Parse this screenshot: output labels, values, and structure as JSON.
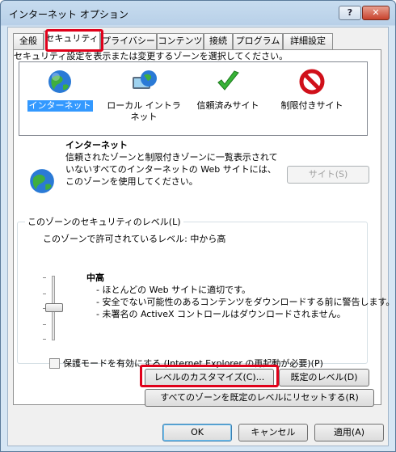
{
  "window": {
    "title": "インターネット オプション",
    "help_label": "?",
    "close_label": "✕"
  },
  "tabs": [
    {
      "label": "全般"
    },
    {
      "label": "セキュリティ"
    },
    {
      "label": "プライバシー"
    },
    {
      "label": "コンテンツ"
    },
    {
      "label": "接続"
    },
    {
      "label": "プログラム"
    },
    {
      "label": "詳細設定"
    }
  ],
  "instruction": "セキュリティ設定を表示または変更するゾーンを選択してください。",
  "zones": [
    {
      "label": "インターネット",
      "icon": "globe-icon"
    },
    {
      "label": "ローカル イントラネット",
      "icon": "intranet-icon"
    },
    {
      "label": "信頼済みサイト",
      "icon": "checkmark-icon"
    },
    {
      "label": "制限付きサイト",
      "icon": "restricted-icon"
    }
  ],
  "zone_info": {
    "name": "インターネット",
    "description": "信頼されたゾーンと制限付きゾーンに一覧表示されていないすべてのインターネットの Web サイトには、このゾーンを使用してください。",
    "sites_button": "サイト(S)"
  },
  "security_level": {
    "group_title": "このゾーンのセキュリティのレベル(L)",
    "allowed": "このゾーンで許可されているレベル: 中から高",
    "level_name": "中高",
    "level_details": [
      "ほとんどの Web サイトに適切です。",
      "安全でない可能性のあるコンテンツをダウンロードする前に警告します。",
      "未署名の ActiveX コントロールはダウンロードされません。"
    ],
    "level_value_fraction": 0.5,
    "protected_mode_label": "保護モードを有効にする (Internet Explorer の再起動が必要)(P)",
    "custom_level_button": "レベルのカスタマイズ(C)...",
    "default_level_button": "既定のレベル(D)",
    "reset_all_button": "すべてのゾーンを既定のレベルにリセットする(R)"
  },
  "footer": {
    "ok": "OK",
    "cancel": "キャンセル",
    "apply": "適用(A)"
  },
  "colors": {
    "highlight": "#e0001a",
    "selection": "#3399ff"
  }
}
